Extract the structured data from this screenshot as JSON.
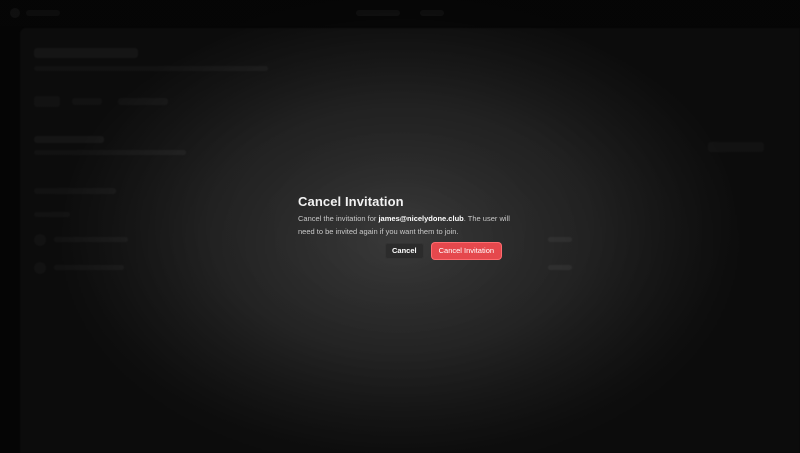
{
  "dialog": {
    "title": "Cancel Invitation",
    "body_prefix": "Cancel the invitation for ",
    "email": "james@nicelydone.club",
    "body_suffix": ". The user will need to be invited again if you want them to join.",
    "cancel_label": "Cancel",
    "confirm_label": "Cancel Invitation"
  },
  "colors": {
    "danger": "#e5484d",
    "panel": "#2a2a2a",
    "backdrop": "#0a0a0a"
  }
}
